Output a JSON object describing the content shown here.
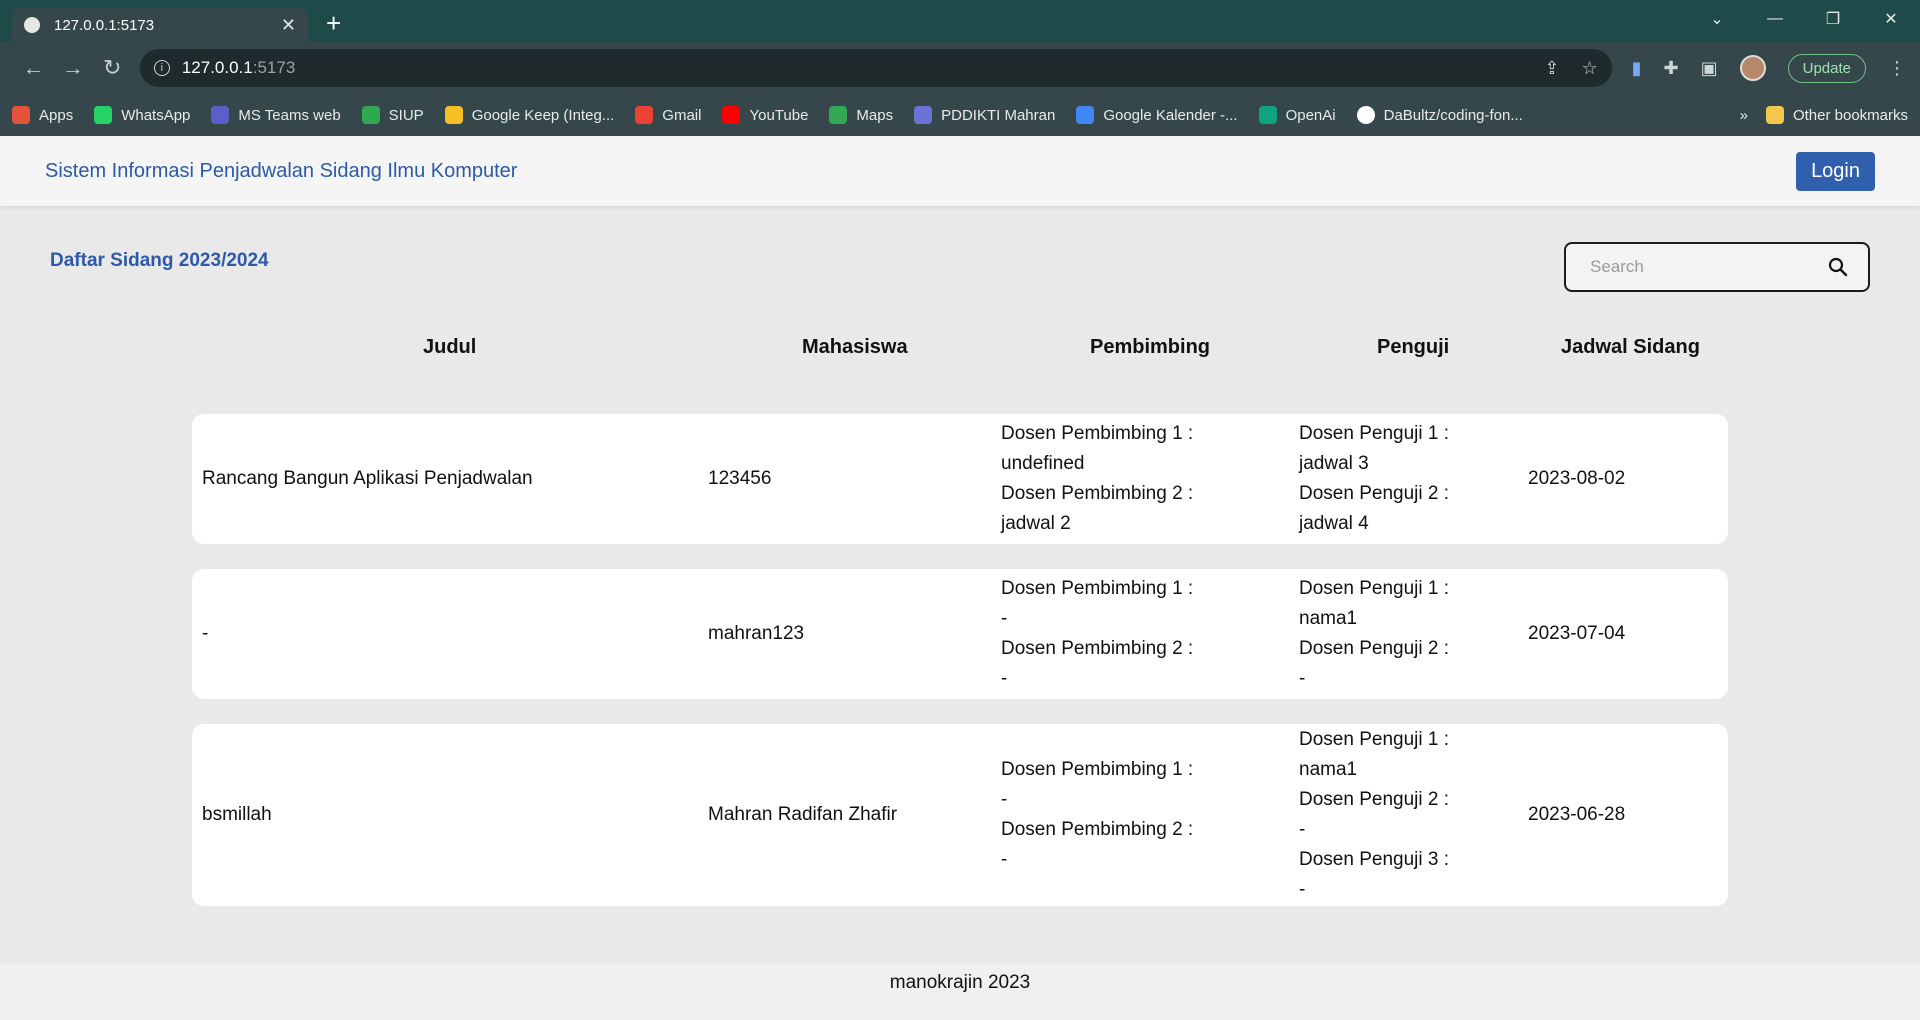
{
  "browser": {
    "tab_title": "127.0.0.1:5173",
    "url_host": "127.0.0.1",
    "url_port": ":5173",
    "update_label": "Update",
    "bookmarks": [
      {
        "label": "Apps",
        "color": "#e5533d"
      },
      {
        "label": "WhatsApp",
        "color": "#25d366"
      },
      {
        "label": "MS Teams web",
        "color": "#5b5fc7"
      },
      {
        "label": "SIUP",
        "color": "#2fa84f"
      },
      {
        "label": "Google Keep (Integ...",
        "color": "#f6bf26"
      },
      {
        "label": "Gmail",
        "color": "#ea4335"
      },
      {
        "label": "YouTube",
        "color": "#ff0000"
      },
      {
        "label": "Maps",
        "color": "#34a853"
      },
      {
        "label": "PDDIKTI Mahran",
        "color": "#6b74d6"
      },
      {
        "label": "Google Kalender -...",
        "color": "#4285f4"
      },
      {
        "label": "OpenAi",
        "color": "#10a37f"
      },
      {
        "label": "DaBultz/coding-fon...",
        "color": "#ffffff"
      }
    ],
    "more_label": "»",
    "other_bookmarks": "Other bookmarks"
  },
  "navbar": {
    "brand": "Sistem Informasi Penjadwalan Sidang Ilmu Komputer",
    "login_label": "Login"
  },
  "main": {
    "title": "Daftar Sidang 2023/2024",
    "search_placeholder": "Search"
  },
  "table": {
    "headers": [
      "Judul",
      "Mahasiswa",
      "Pembimbing",
      "Penguji",
      "Jadwal Sidang"
    ],
    "rows": [
      {
        "judul": "Rancang Bangun Aplikasi Penjadwalan",
        "mahasiswa": "123456",
        "pembimbing": [
          "Dosen Pembimbing 1 :",
          "undefined",
          "Dosen Pembimbing 2 :",
          "jadwal 2"
        ],
        "penguji": [
          "Dosen Penguji 1 :",
          "jadwal 3",
          "Dosen Penguji 2 :",
          "jadwal 4"
        ],
        "jadwal": "2023-08-02"
      },
      {
        "judul": "-",
        "mahasiswa": "mahran123",
        "pembimbing": [
          "Dosen Pembimbing 1 :",
          "-",
          "Dosen Pembimbing 2 :",
          "-"
        ],
        "penguji": [
          "Dosen Penguji 1 :",
          "nama1",
          "Dosen Penguji 2 :",
          "-"
        ],
        "jadwal": "2023-07-04"
      },
      {
        "judul": "bsmillah",
        "mahasiswa": "Mahran Radifan Zhafir",
        "pembimbing": [
          "Dosen Pembimbing 1 :",
          "-",
          "Dosen Pembimbing 2 :",
          "-"
        ],
        "penguji": [
          "Dosen Penguji 1 :",
          "nama1",
          "Dosen Penguji 2 :",
          "-",
          "Dosen Penguji 3 :",
          "-"
        ],
        "jadwal": "2023-06-28"
      }
    ]
  },
  "footer": {
    "text": "manokrajin 2023"
  }
}
